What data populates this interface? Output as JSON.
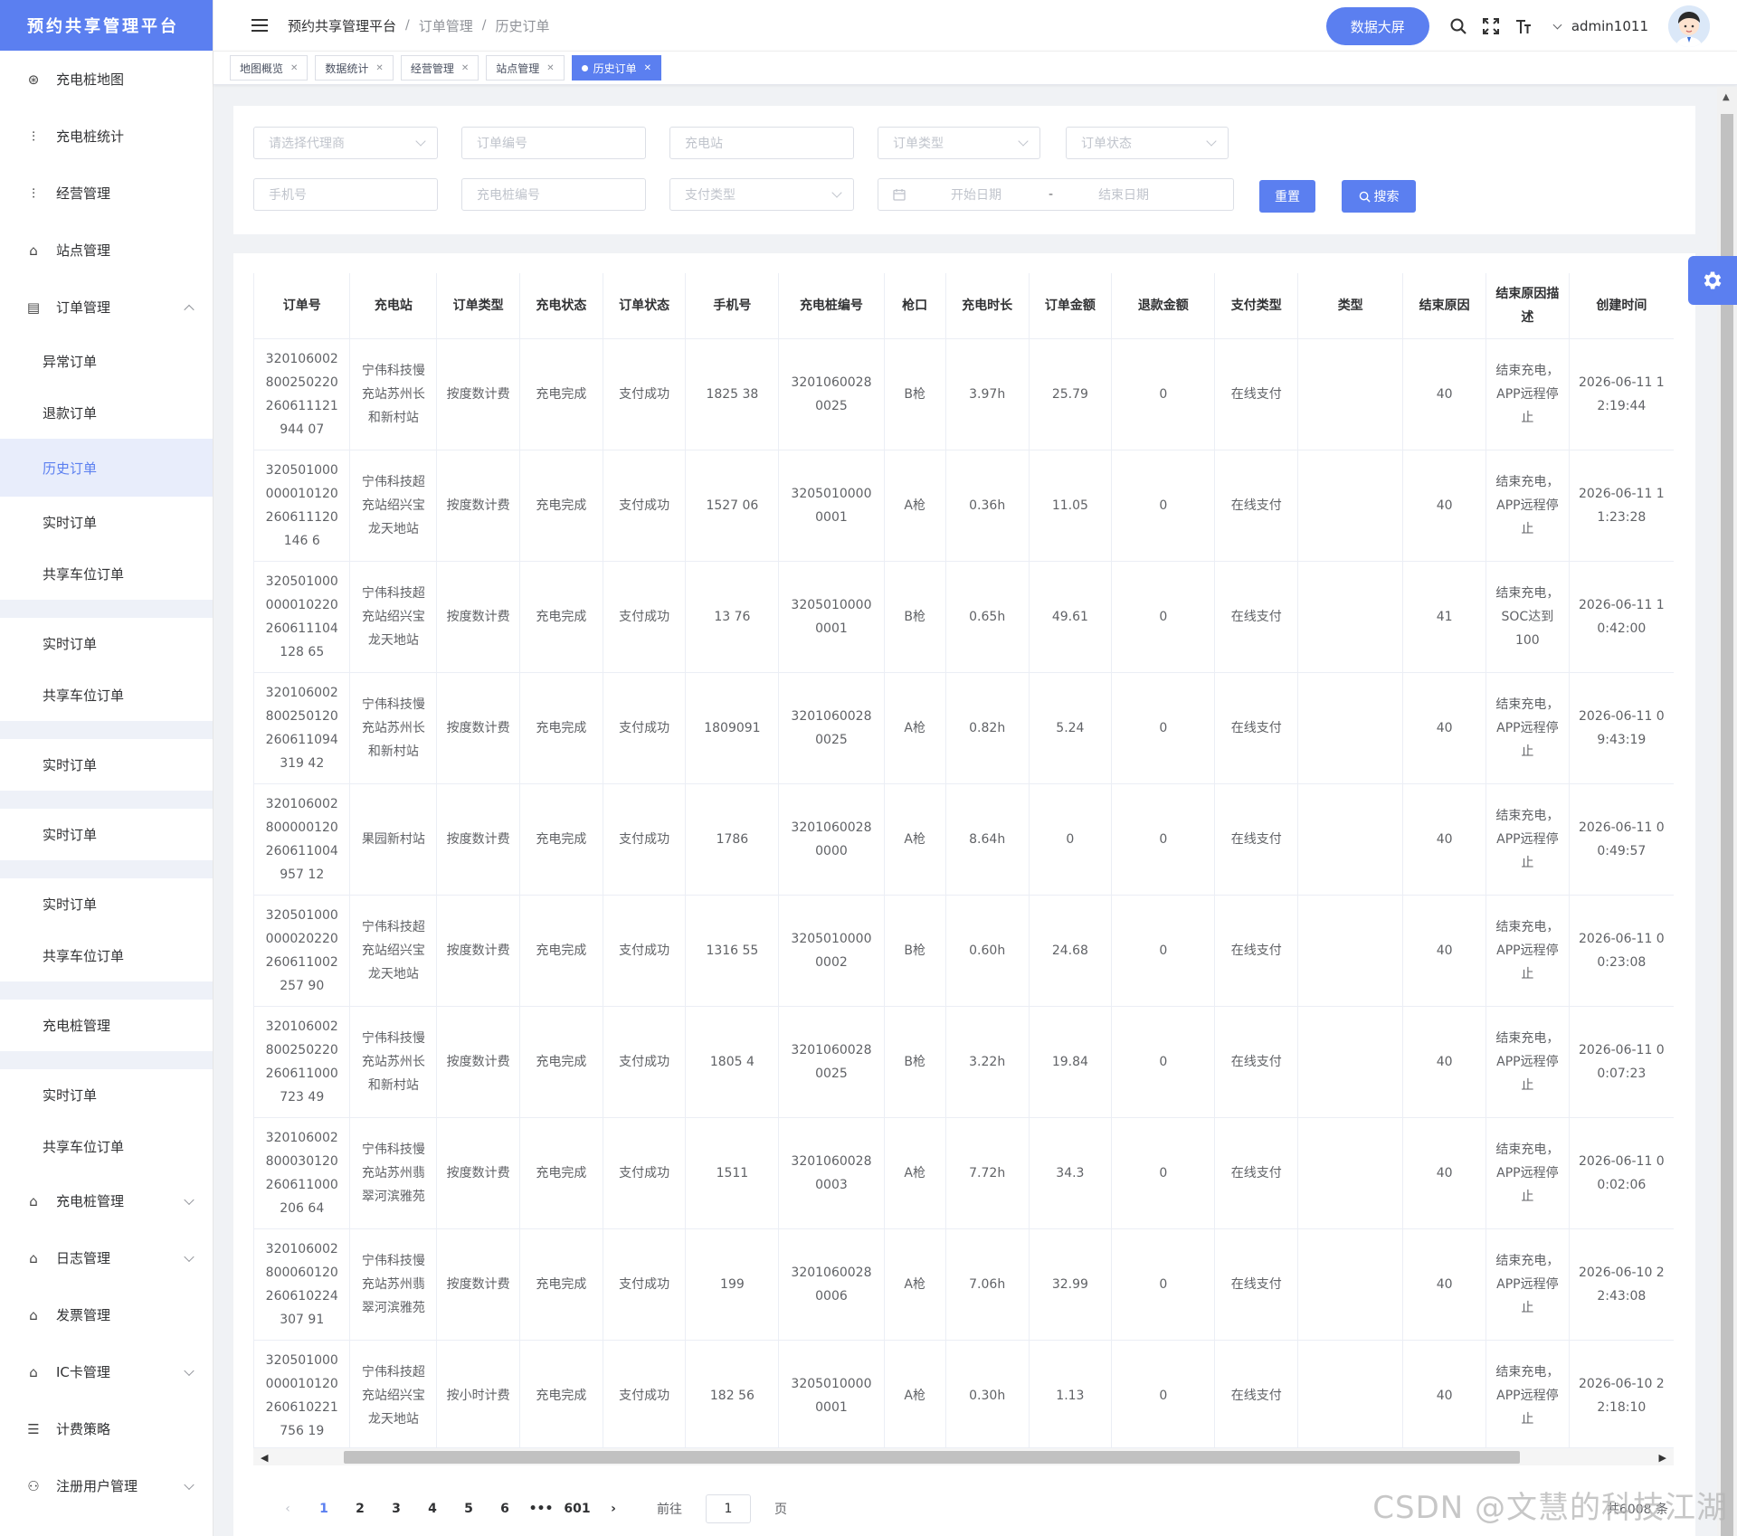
{
  "app": {
    "logo": "预约共享管理平台"
  },
  "sidebar": {
    "items": [
      {
        "label": "充电桩地图"
      },
      {
        "label": "充电桩统计"
      },
      {
        "label": "经营管理"
      },
      {
        "label": "站点管理"
      },
      {
        "label": "订单管理"
      }
    ],
    "order_sub": [
      "异常订单",
      "退款订单",
      "历史订单",
      "实时订单",
      "共享车位订单",
      "实时订单",
      "共享车位订单",
      "实时订单",
      "实时订单",
      "实时订单",
      "共享车位订单",
      "充电桩管理",
      "实时订单",
      "共享车位订单"
    ],
    "bottom_items": [
      {
        "label": "充电桩管理"
      },
      {
        "label": "日志管理"
      },
      {
        "label": "发票管理"
      },
      {
        "label": "IC卡管理"
      },
      {
        "label": "计费策略"
      },
      {
        "label": "注册用户管理"
      }
    ]
  },
  "header": {
    "breadcrumb": [
      "预约共享管理平台",
      "订单管理",
      "历史订单"
    ],
    "screen_button": "数据大屏",
    "username": "admin1011"
  },
  "tags": [
    "地图概览",
    "数据统计",
    "经营管理",
    "站点管理",
    "历史订单"
  ],
  "filters": {
    "agent": "请选择代理商",
    "order_no": "订单编号",
    "station": "充电站",
    "order_type": "订单类型",
    "order_status": "订单状态",
    "phone": "手机号",
    "pile_no": "充电桩编号",
    "pay_type": "支付类型",
    "start_date": "开始日期",
    "date_sep": "-",
    "end_date": "结束日期",
    "reset": "重置",
    "search": "搜索"
  },
  "table": {
    "headers": [
      "订单号",
      "充电站",
      "订单类型",
      "充电状态",
      "订单状态",
      "手机号",
      "充电桩编号",
      "枪口",
      "充电时长",
      "订单金额",
      "退款金额",
      "支付类型",
      "类型",
      "结束原因",
      "结束原因描述",
      "创建时间"
    ],
    "rows": [
      [
        "320106002800250220260611121944 07",
        "宁伟科技慢充站苏州长和新村站",
        "按度数计费",
        "充电完成",
        "支付成功",
        "1825 38",
        "32010600280025",
        "B枪",
        "3.97h",
        "25.79",
        "0",
        "在线支付",
        "",
        "40",
        "结束充电，APP远程停止",
        "2026-06-11 12:19:44"
      ],
      [
        "320501000000010120260611120146 6",
        "宁伟科技超充站绍兴宝龙天地站",
        "按度数计费",
        "充电完成",
        "支付成功",
        "1527 06",
        "32050100000001",
        "A枪",
        "0.36h",
        "11.05",
        "0",
        "在线支付",
        "",
        "40",
        "结束充电，APP远程停止",
        "2026-06-11 11:23:28"
      ],
      [
        "320501000000010220260611104128 65",
        "宁伟科技超充站绍兴宝龙天地站",
        "按度数计费",
        "充电完成",
        "支付成功",
        "13 76",
        "32050100000001",
        "B枪",
        "0.65h",
        "49.61",
        "0",
        "在线支付",
        "",
        "41",
        "结束充电，SOC达到 100",
        "2026-06-11 10:42:00"
      ],
      [
        "320106002800250120260611094319 42",
        "宁伟科技慢充站苏州长和新村站",
        "按度数计费",
        "充电完成",
        "支付成功",
        "1809091",
        "32010600280025",
        "A枪",
        "0.82h",
        "5.24",
        "0",
        "在线支付",
        "",
        "40",
        "结束充电，APP远程停止",
        "2026-06-11 09:43:19"
      ],
      [
        "320106002800000120260611004957 12",
        "果园新村站",
        "按度数计费",
        "充电完成",
        "支付成功",
        "1786",
        "32010600280000",
        "A枪",
        "8.64h",
        "0",
        "0",
        "在线支付",
        "",
        "40",
        "结束充电，APP远程停止",
        "2026-06-11 00:49:57"
      ],
      [
        "320501000000020220260611002257 90",
        "宁伟科技超充站绍兴宝龙天地站",
        "按度数计费",
        "充电完成",
        "支付成功",
        "1316 55",
        "32050100000002",
        "B枪",
        "0.60h",
        "24.68",
        "0",
        "在线支付",
        "",
        "40",
        "结束充电，APP远程停止",
        "2026-06-11 00:23:08"
      ],
      [
        "320106002800250220260611000723 49",
        "宁伟科技慢充站苏州长和新村站",
        "按度数计费",
        "充电完成",
        "支付成功",
        "1805 4",
        "32010600280025",
        "B枪",
        "3.22h",
        "19.84",
        "0",
        "在线支付",
        "",
        "40",
        "结束充电，APP远程停止",
        "2026-06-11 00:07:23"
      ],
      [
        "320106002800030120260611000206 64",
        "宁伟科技慢充站苏州翡翠河滨雅苑",
        "按度数计费",
        "充电完成",
        "支付成功",
        "1511",
        "32010600280003",
        "A枪",
        "7.72h",
        "34.3",
        "0",
        "在线支付",
        "",
        "40",
        "结束充电，APP远程停止",
        "2026-06-11 00:02:06"
      ],
      [
        "320106002800060120260610224307 91",
        "宁伟科技慢充站苏州翡翠河滨雅苑",
        "按度数计费",
        "充电完成",
        "支付成功",
        "199",
        "32010600280006",
        "A枪",
        "7.06h",
        "32.99",
        "0",
        "在线支付",
        "",
        "40",
        "结束充电，APP远程停止",
        "2026-06-10 22:43:08"
      ],
      [
        "320501000000010120260610221756 19",
        "宁伟科技超充站绍兴宝龙天地站",
        "按小时计费",
        "充电完成",
        "支付成功",
        "182 56",
        "32050100000001",
        "A枪",
        "0.30h",
        "1.13",
        "0",
        "在线支付",
        "",
        "40",
        "结束充电，APP远程停止",
        "2026-06-10 22:18:10"
      ]
    ]
  },
  "pager": {
    "pages": [
      "1",
      "2",
      "3",
      "4",
      "5",
      "6",
      "•••",
      "601"
    ],
    "goto_label": "前往",
    "goto_value": "1",
    "page_unit": "页",
    "total": "共6008 条"
  },
  "watermark": "CSDN @文慧的科技江湖",
  "colors": {
    "accent": "#5b7ff0"
  }
}
